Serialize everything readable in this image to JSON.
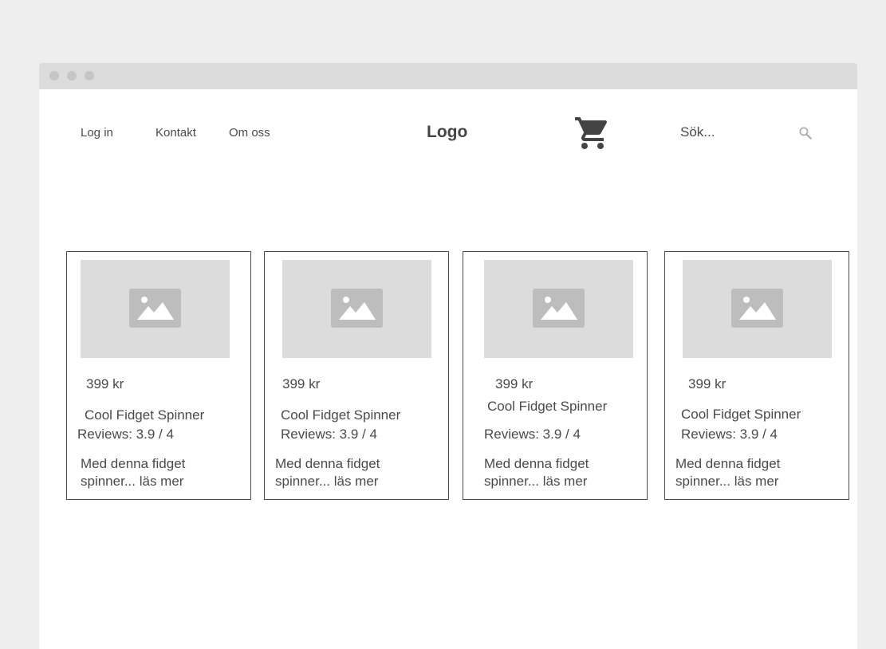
{
  "header": {
    "nav": [
      {
        "label": "Log in"
      },
      {
        "label": "Kontakt"
      },
      {
        "label": "Om oss"
      }
    ],
    "logo": "Logo",
    "cart_icon": "shopping-cart-icon",
    "search": {
      "placeholder": "Sök...",
      "icon": "magnifier-icon"
    }
  },
  "products": [
    {
      "price": "399 kr",
      "name": "Cool Fidget Spinner",
      "reviews": "Reviews: 3.9 / 4",
      "description": "Med denna fidget spinner... läs mer"
    },
    {
      "price": "399 kr",
      "name": "Cool Fidget Spinner",
      "reviews": "Reviews: 3.9 / 4",
      "description": "Med denna fidget spinner... läs mer"
    },
    {
      "price": "399 kr",
      "name": "Cool Fidget Spinner",
      "reviews": "Reviews: 3.9 / 4",
      "description": "Med denna fidget spinner... läs mer"
    },
    {
      "price": "399 kr",
      "name": "Cool Fidget Spinner",
      "reviews": "Reviews: 3.9 / 4",
      "description": "Med denna fidget spinner... läs mer"
    }
  ],
  "colors": {
    "background": "#eeeeee",
    "titlebar": "#dcdcdc",
    "text": "#4a4a4a",
    "placeholder_image": "#dcdcdc"
  }
}
